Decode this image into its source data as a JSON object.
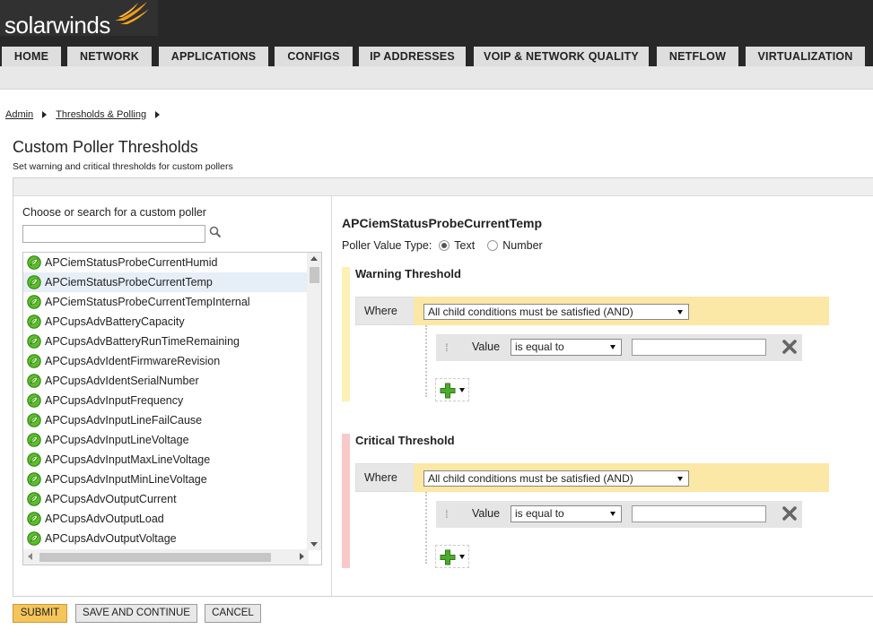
{
  "brand": {
    "name": "solarwinds",
    "flame_color": "#f39c12"
  },
  "nav": {
    "tabs": [
      {
        "label": "HOME"
      },
      {
        "label": "NETWORK"
      },
      {
        "label": "APPLICATIONS"
      },
      {
        "label": "CONFIGS"
      },
      {
        "label": "IP ADDRESSES"
      },
      {
        "label": "VOIP & NETWORK QUALITY"
      },
      {
        "label": "NETFLOW"
      },
      {
        "label": "VIRTUALIZATION"
      }
    ]
  },
  "breadcrumb": {
    "items": [
      "Admin",
      "Thresholds & Polling"
    ]
  },
  "page": {
    "title": "Custom Poller Thresholds",
    "subtitle": "Set warning and critical thresholds for custom pollers"
  },
  "left": {
    "choose_label": "Choose or search for a custom poller",
    "search_value": "",
    "pollers": [
      {
        "name": "APCiemStatusProbeCurrentHumid",
        "selected": false
      },
      {
        "name": "APCiemStatusProbeCurrentTemp",
        "selected": true
      },
      {
        "name": "APCiemStatusProbeCurrentTempInternal",
        "selected": false
      },
      {
        "name": "APCupsAdvBatteryCapacity",
        "selected": false
      },
      {
        "name": "APCupsAdvBatteryRunTimeRemaining",
        "selected": false
      },
      {
        "name": "APCupsAdvIdentFirmwareRevision",
        "selected": false
      },
      {
        "name": "APCupsAdvIdentSerialNumber",
        "selected": false
      },
      {
        "name": "APCupsAdvInputFrequency",
        "selected": false
      },
      {
        "name": "APCupsAdvInputLineFailCause",
        "selected": false
      },
      {
        "name": "APCupsAdvInputLineVoltage",
        "selected": false
      },
      {
        "name": "APCupsAdvInputMaxLineVoltage",
        "selected": false
      },
      {
        "name": "APCupsAdvInputMinLineVoltage",
        "selected": false
      },
      {
        "name": "APCupsAdvOutputCurrent",
        "selected": false
      },
      {
        "name": "APCupsAdvOutputLoad",
        "selected": false
      },
      {
        "name": "APCupsAdvOutputVoltage",
        "selected": false
      }
    ]
  },
  "right": {
    "selected_title": "APCiemStatusProbeCurrentTemp",
    "value_type_label": "Poller Value Type:",
    "value_type_options": [
      "Text",
      "Number"
    ],
    "value_type_selected": "Text",
    "warning": {
      "title": "Warning Threshold",
      "color": "#fdf1b8",
      "where_label": "Where",
      "condition": "All child conditions must be satisfied (AND)",
      "value_label": "Value",
      "operator": "is equal to",
      "value": ""
    },
    "critical": {
      "title": "Critical Threshold",
      "color": "#f7c9c9",
      "where_label": "Where",
      "condition": "All child conditions must be satisfied (AND)",
      "value_label": "Value",
      "operator": "is equal to",
      "value": ""
    }
  },
  "buttons": {
    "submit": "SUBMIT",
    "save_continue": "SAVE AND CONTINUE",
    "cancel": "CANCEL"
  }
}
